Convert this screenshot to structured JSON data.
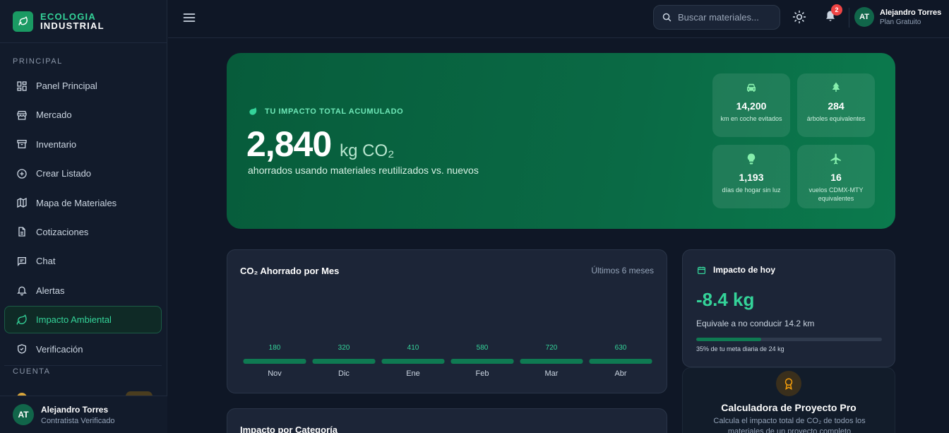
{
  "brand": {
    "line1": "ECOLOGIA",
    "line2": "INDUSTRIAL"
  },
  "sidebar": {
    "section_principal": "PRINCIPAL",
    "section_cuenta": "CUENTA",
    "items": [
      {
        "label": "Panel Principal",
        "icon": "dashboard-icon"
      },
      {
        "label": "Mercado",
        "icon": "store-icon"
      },
      {
        "label": "Inventario",
        "icon": "archive-icon"
      },
      {
        "label": "Crear Listado",
        "icon": "plus-circle-icon"
      },
      {
        "label": "Mapa de Materiales",
        "icon": "map-icon"
      },
      {
        "label": "Cotizaciones",
        "icon": "document-icon"
      },
      {
        "label": "Chat",
        "icon": "chat-icon"
      },
      {
        "label": "Alertas",
        "icon": "bell-icon"
      },
      {
        "label": "Impacto Ambiental",
        "icon": "leaf-icon",
        "active": true
      },
      {
        "label": "Verificación",
        "icon": "shield-check-icon"
      }
    ],
    "user": {
      "initials": "AT",
      "name": "Alejandro Torres",
      "role": "Contratista Verificado"
    }
  },
  "topbar": {
    "search_placeholder": "Buscar materiales...",
    "notifications_count": "2",
    "user": {
      "initials": "AT",
      "name": "Alejandro Torres",
      "plan": "Plan Gratuito"
    }
  },
  "hero": {
    "label": "TU IMPACTO TOTAL ACUMULADO",
    "value": "2,840",
    "unit": "kg CO₂",
    "description": "ahorrados usando materiales reutilizados vs. nuevos",
    "stats": [
      {
        "icon": "car-icon",
        "value": "14,200",
        "label": "km en coche evitados"
      },
      {
        "icon": "trees-icon",
        "value": "284",
        "label": "árboles equivalentes"
      },
      {
        "icon": "lightbulb-icon",
        "value": "1,193",
        "label": "días de hogar sin luz"
      },
      {
        "icon": "plane-icon",
        "value": "16",
        "label": "vuelos CDMX-MTY equivalentes"
      }
    ]
  },
  "chart_card": {
    "title": "CO₂ Ahorrado por Mes",
    "subtitle": "Últimos 6 meses"
  },
  "chart_data": {
    "type": "bar",
    "title": "CO₂ Ahorrado por Mes",
    "categories": [
      "Nov",
      "Dic",
      "Ene",
      "Feb",
      "Mar",
      "Abr"
    ],
    "values": [
      180,
      320,
      410,
      580,
      720,
      630
    ],
    "value_labels": [
      "180",
      "320",
      "410",
      "580",
      "720",
      "630"
    ],
    "colors": {
      "bar": "#0f7a52",
      "label": "#34d399"
    }
  },
  "category_card": {
    "title": "Impacto por Categoría"
  },
  "today": {
    "title": "Impacto de hoy",
    "value": "-8.4 kg",
    "description": "Equivale a no conducir 14.2 km",
    "progress": 0.35,
    "note": "35% de tu meta diaria de 24 kg"
  },
  "pro": {
    "title": "Calculadora de Proyecto Pro",
    "description": "Calcula el impacto total de CO₂ de todos los materiales de un proyecto completo"
  },
  "colors": {
    "accent": "#34d399",
    "accent_dark": "#0f7a52",
    "bg": "#0f1726",
    "card": "#1c2537"
  }
}
